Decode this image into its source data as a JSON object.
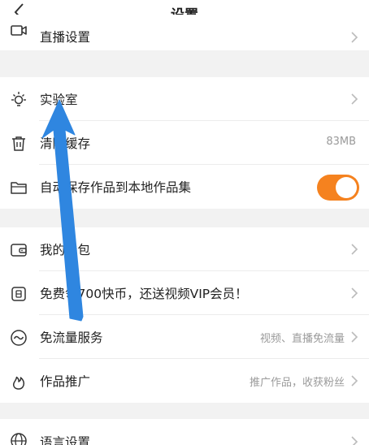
{
  "header": {
    "title": "设置"
  },
  "groups": [
    {
      "items": [
        {
          "label": "直播设置",
          "icon": "video-camera-icon"
        }
      ]
    },
    {
      "items": [
        {
          "label": "实验室",
          "icon": "lightbulb-icon"
        },
        {
          "label": "清除缓存",
          "value": "83MB",
          "icon": "trash-icon"
        },
        {
          "label": "自动保存作品到本地作品集",
          "icon": "folder-icon",
          "toggle": true
        }
      ]
    },
    {
      "items": [
        {
          "label": "我的钱包",
          "icon": "wallet-icon"
        },
        {
          "label": "免费领700快币，还送视频VIP会员！",
          "icon": "coin-icon"
        },
        {
          "label": "免流量服务",
          "value": "视频、直播免流量",
          "icon": "wave-icon"
        },
        {
          "label": "作品推广",
          "value": "推广作品，收获粉丝",
          "icon": "flame-icon"
        }
      ]
    },
    {
      "items": [
        {
          "label": "语言设置",
          "icon": "globe-icon"
        }
      ]
    }
  ],
  "colors": {
    "accent": "#f5821f",
    "annotation_arrow": "#2f86e0"
  }
}
